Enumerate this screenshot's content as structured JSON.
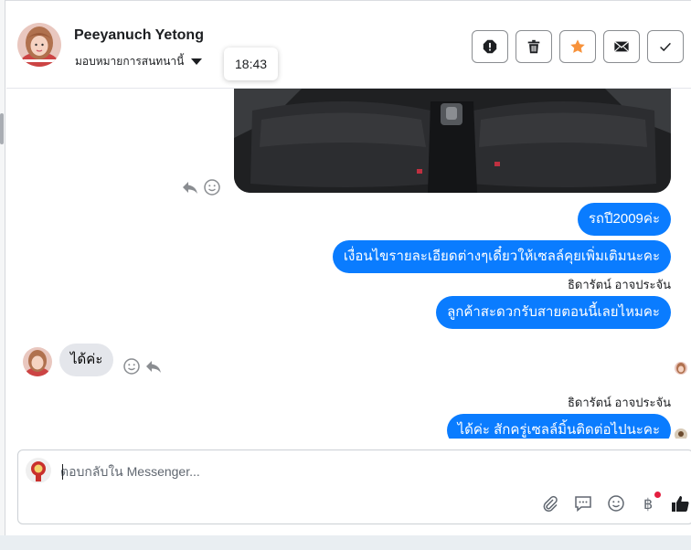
{
  "colors": {
    "accent": "#0a7cff",
    "star": "#f7923b",
    "incoming_bubble": "#e4e6eb",
    "notification_dot": "#e41e3f"
  },
  "header": {
    "contact_name": "Peeyanuch Yetong",
    "assign_label": "มอบหมายการสนทนานี้",
    "tooltip_time": "18:43",
    "actions": [
      {
        "icon": "report-icon",
        "label": "Report"
      },
      {
        "icon": "trash-icon",
        "label": "Delete"
      },
      {
        "icon": "star-icon",
        "label": "Star"
      },
      {
        "icon": "envelope-icon",
        "label": "Mark unread"
      },
      {
        "icon": "checkmark-icon",
        "label": "Done"
      }
    ]
  },
  "messages": {
    "out_1": "รถปี2009ค่ะ",
    "out_2": "เงื่อนไขรายละเอียดต่างๆเดี๋ยวให้เซลล์คุยเพิ่มเติมนะคะ",
    "sender_1": "ธิดารัตน์ อาจประจัน",
    "out_3": "ลูกค้าสะดวกรับสายตอนนี้เลยไหมคะ",
    "in_1": "ได้ค่ะ",
    "sender_2": "ธิดารัตน์ อาจประจัน",
    "out_4": "ได้ค่ะ สักครู่เซลล์มิ้นติดต่อไปนะคะ"
  },
  "composer": {
    "placeholder": "ตอบกลับใน Messenger...",
    "tools": [
      "attachment-icon",
      "saved-replies-icon",
      "emoji-icon",
      "payment-icon",
      "like-icon"
    ]
  }
}
